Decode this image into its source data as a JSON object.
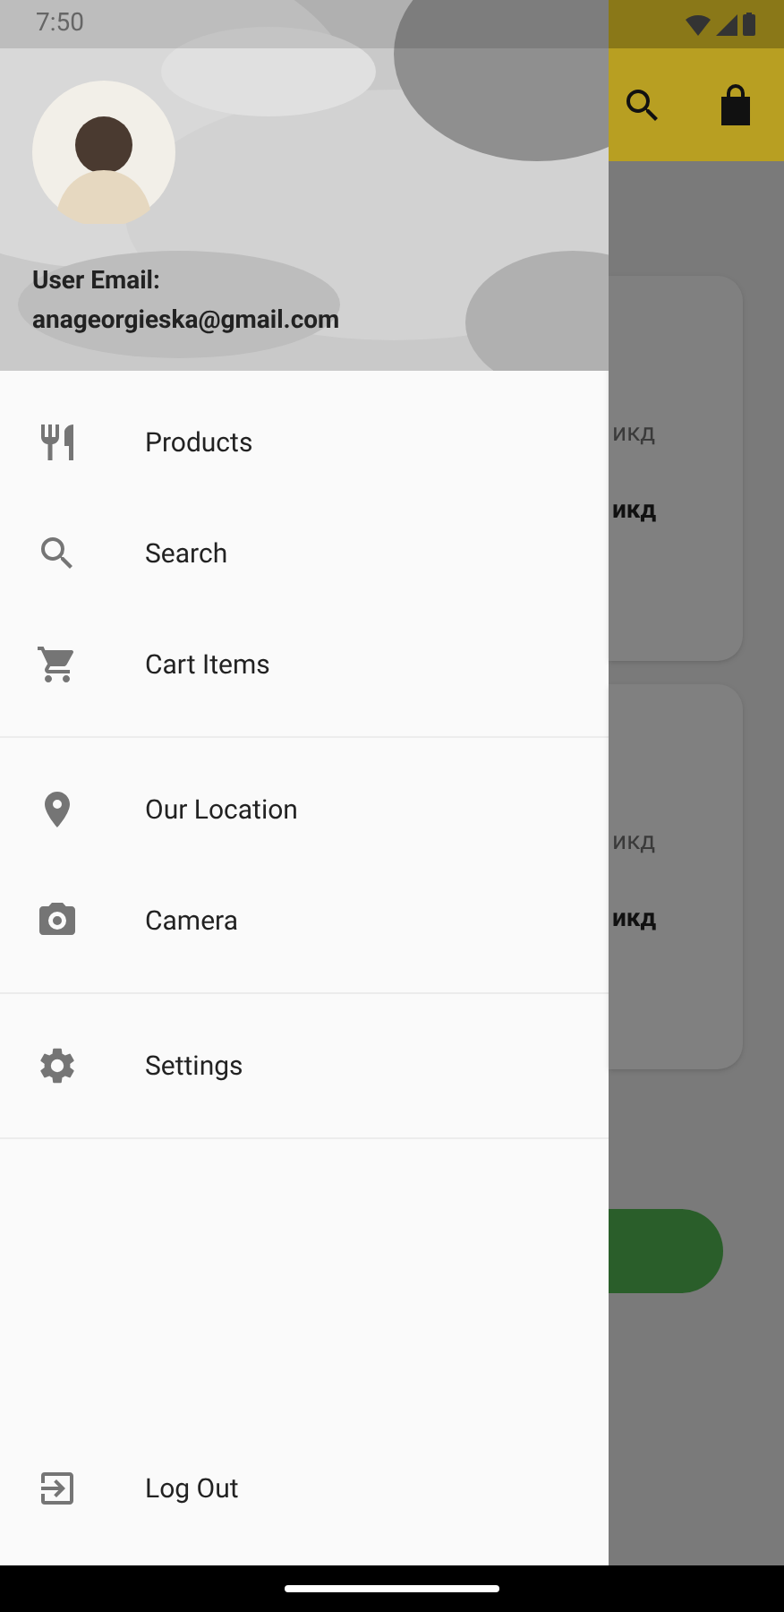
{
  "status_bar": {
    "time": "7:50"
  },
  "drawer": {
    "header": {
      "email_label": "User Email:",
      "email": "anageorgieska@gmail.com"
    },
    "sections": [
      {
        "items": [
          {
            "kind": "products",
            "label": "Products"
          },
          {
            "kind": "search",
            "label": "Search"
          },
          {
            "kind": "cart",
            "label": "Cart Items"
          }
        ]
      },
      {
        "items": [
          {
            "kind": "location",
            "label": "Our Location"
          },
          {
            "kind": "camera",
            "label": "Camera"
          }
        ]
      },
      {
        "items": [
          {
            "kind": "settings",
            "label": "Settings"
          }
        ]
      }
    ],
    "footer_item": {
      "kind": "logout",
      "label": "Log Out"
    }
  },
  "background": {
    "cards": [
      {
        "texts": [
          {
            "kind": "secondary",
            "text": "икд"
          },
          {
            "kind": "primary",
            "text": "икд"
          }
        ]
      },
      {
        "texts": [
          {
            "kind": "secondary",
            "text": "икд"
          },
          {
            "kind": "primary",
            "text": "икд"
          }
        ]
      }
    ]
  }
}
